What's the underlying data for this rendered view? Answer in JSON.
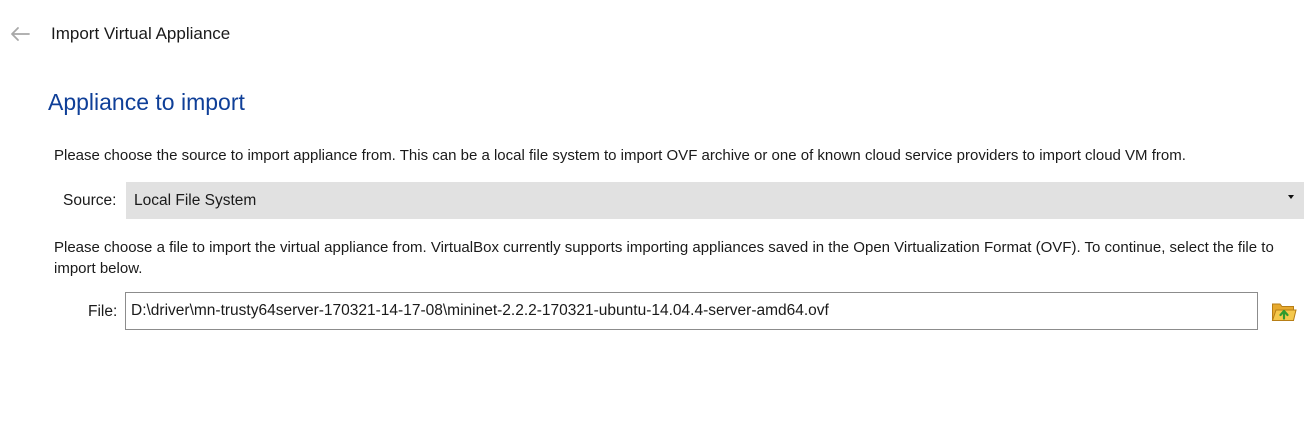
{
  "window": {
    "title": "Import Virtual Appliance",
    "back_icon": "back-arrow-icon"
  },
  "page": {
    "heading": "Appliance to import",
    "heading_color": "#0f3f98",
    "source_description": "Please choose the source to import appliance from. This can be a local file system to import OVF archive or one of known cloud service providers to import cloud VM from.",
    "file_description": "Please choose a file to import the virtual appliance from. VirtualBox currently supports importing appliances saved in the Open Virtualization Format (OVF). To continue, select the file to import below."
  },
  "source": {
    "label": "Source:",
    "selected": "Local File System",
    "dropdown_icon": "chevron-down-icon"
  },
  "file": {
    "label": "File:",
    "value": "D:\\driver\\mn-trusty64server-170321-14-17-08\\mininet-2.2.2-170321-ubuntu-14.04.4-server-amd64.ovf",
    "browse_icon": "folder-open-icon"
  }
}
